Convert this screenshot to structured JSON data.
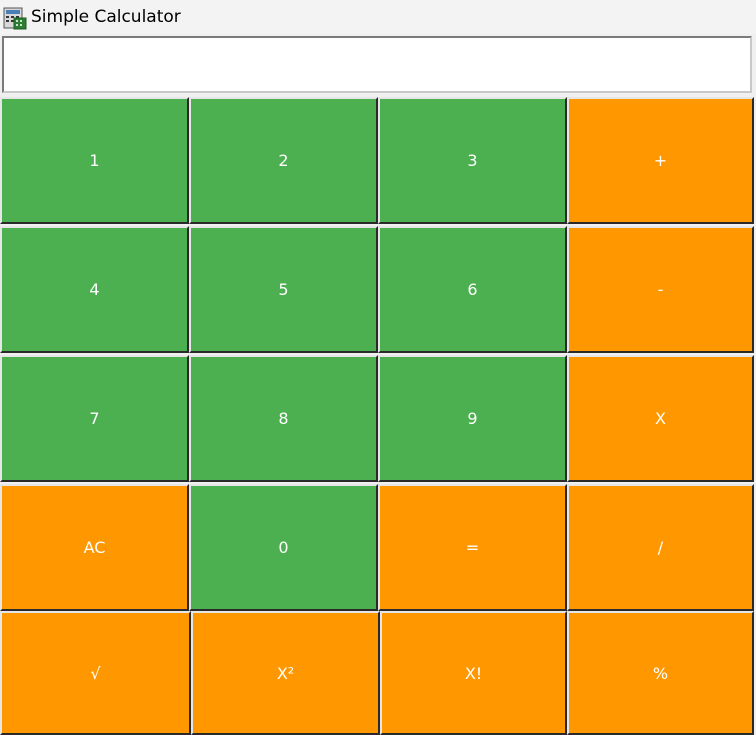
{
  "window": {
    "title": "Simple Calculator",
    "icon": "calculator-icon"
  },
  "display": {
    "value": ""
  },
  "colors": {
    "number_button": "#4caf50",
    "operator_button": "#ff9800",
    "button_text": "#ffffff"
  },
  "buttons": {
    "one": "1",
    "two": "2",
    "three": "3",
    "plus": "+",
    "four": "4",
    "five": "5",
    "six": "6",
    "minus": "-",
    "seven": "7",
    "eight": "8",
    "nine": "9",
    "multiply": "X",
    "clear": "AC",
    "zero": "0",
    "equals": "=",
    "divide": "/",
    "sqrt": "√",
    "square": "X²",
    "factorial": "X!",
    "percent": "%"
  }
}
